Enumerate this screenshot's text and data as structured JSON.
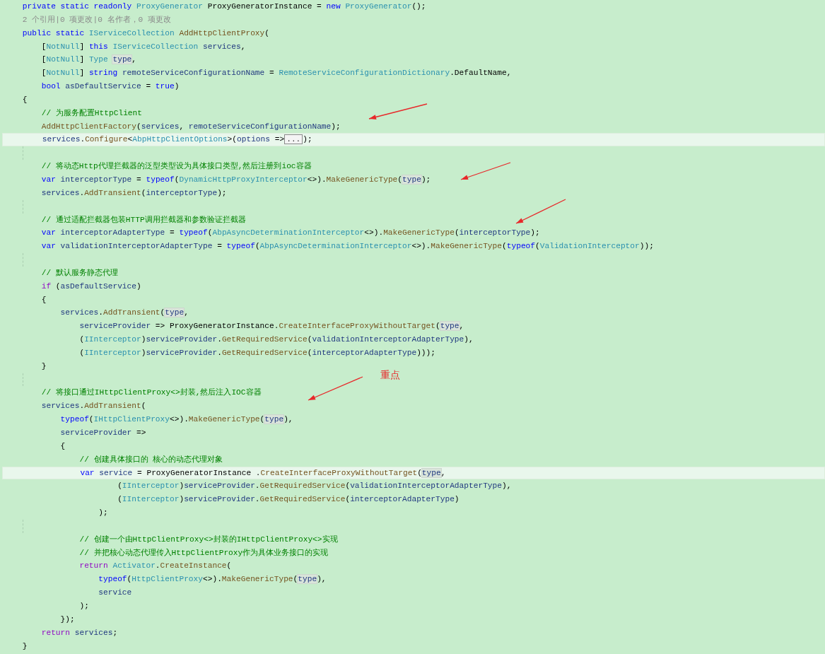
{
  "editor": {
    "lines": [
      {
        "highlighted": false,
        "tokens": [
          {
            "kind": "kw",
            "text": "    private static readonly "
          },
          {
            "kind": "type",
            "text": "ProxyGenerator"
          },
          {
            "kind": "plain",
            "text": " ProxyGeneratorInstance = "
          },
          {
            "kind": "kw",
            "text": "new "
          },
          {
            "kind": "type",
            "text": "ProxyGenerator"
          },
          {
            "kind": "plain",
            "text": "();"
          }
        ]
      },
      {
        "highlighted": false,
        "tokens": [
          {
            "kind": "lens",
            "text": "    2 个引用|0 项更改|0 名作者，0 项更改"
          }
        ]
      },
      {
        "highlighted": false,
        "tokens": [
          {
            "kind": "kw",
            "text": "    public static "
          },
          {
            "kind": "type",
            "text": "IServiceCollection "
          },
          {
            "kind": "method",
            "text": "AddHttpClientProxy"
          },
          {
            "kind": "plain",
            "text": "("
          }
        ]
      },
      {
        "highlighted": false,
        "tokens": [
          {
            "kind": "plain",
            "text": "        ["
          },
          {
            "kind": "type",
            "text": "NotNull"
          },
          {
            "kind": "plain",
            "text": "] "
          },
          {
            "kind": "kw",
            "text": "this "
          },
          {
            "kind": "type",
            "text": "IServiceCollection "
          },
          {
            "kind": "ident",
            "text": "services"
          },
          {
            "kind": "plain",
            "text": ","
          }
        ]
      },
      {
        "highlighted": false,
        "tokens": [
          {
            "kind": "plain",
            "text": "        ["
          },
          {
            "kind": "type",
            "text": "NotNull"
          },
          {
            "kind": "plain",
            "text": "] "
          },
          {
            "kind": "type",
            "text": "Type "
          },
          {
            "kind": "ref",
            "text": "type"
          },
          {
            "kind": "plain",
            "text": ","
          }
        ]
      },
      {
        "highlighted": false,
        "tokens": [
          {
            "kind": "plain",
            "text": "        ["
          },
          {
            "kind": "type",
            "text": "NotNull"
          },
          {
            "kind": "plain",
            "text": "] "
          },
          {
            "kind": "kw",
            "text": "string "
          },
          {
            "kind": "ident",
            "text": "remoteServiceConfigurationName"
          },
          {
            "kind": "plain",
            "text": " = "
          },
          {
            "kind": "type",
            "text": "RemoteServiceConfigurationDictionary"
          },
          {
            "kind": "plain",
            "text": ".DefaultName,"
          }
        ]
      },
      {
        "highlighted": false,
        "tokens": [
          {
            "kind": "kw",
            "text": "        bool "
          },
          {
            "kind": "ident",
            "text": "asDefaultService"
          },
          {
            "kind": "plain",
            "text": " = "
          },
          {
            "kind": "kw",
            "text": "true"
          },
          {
            "kind": "plain",
            "text": ")"
          }
        ]
      },
      {
        "highlighted": false,
        "tokens": [
          {
            "kind": "plain",
            "text": "    {"
          }
        ]
      },
      {
        "highlighted": false,
        "tokens": [
          {
            "kind": "comment",
            "text": "        // 为服务配置HttpClient"
          }
        ]
      },
      {
        "highlighted": false,
        "tokens": [
          {
            "kind": "method",
            "text": "        AddHttpClientFactory"
          },
          {
            "kind": "plain",
            "text": "("
          },
          {
            "kind": "ident",
            "text": "services"
          },
          {
            "kind": "plain",
            "text": ", "
          },
          {
            "kind": "ident",
            "text": "remoteServiceConfigurationName"
          },
          {
            "kind": "plain",
            "text": ");"
          }
        ]
      },
      {
        "highlighted": true,
        "tokens": [
          {
            "kind": "ident",
            "text": "        services"
          },
          {
            "kind": "plain",
            "text": "."
          },
          {
            "kind": "method",
            "text": "Configure"
          },
          {
            "kind": "plain",
            "text": "<"
          },
          {
            "kind": "type",
            "text": "AbpHttpClientOptions"
          },
          {
            "kind": "plain",
            "text": ">("
          },
          {
            "kind": "ident",
            "text": "options"
          },
          {
            "kind": "plain",
            "text": " =>"
          },
          {
            "kind": "fold",
            "text": "..."
          },
          {
            "kind": "plain",
            "text": ");"
          }
        ]
      },
      {
        "kind": "blank"
      },
      {
        "highlighted": false,
        "tokens": [
          {
            "kind": "comment",
            "text": "        // 将动态Http代理拦截器的泛型类型设为具体接口类型,然后注册到ioc容器"
          }
        ]
      },
      {
        "highlighted": false,
        "tokens": [
          {
            "kind": "kw",
            "text": "        var "
          },
          {
            "kind": "ident",
            "text": "interceptorType"
          },
          {
            "kind": "plain",
            "text": " = "
          },
          {
            "kind": "kw",
            "text": "typeof"
          },
          {
            "kind": "plain",
            "text": "("
          },
          {
            "kind": "type",
            "text": "DynamicHttpProxyInterceptor"
          },
          {
            "kind": "plain",
            "text": "<>)."
          },
          {
            "kind": "method",
            "text": "MakeGenericType"
          },
          {
            "kind": "plain",
            "text": "("
          },
          {
            "kind": "ref",
            "text": "type"
          },
          {
            "kind": "plain",
            "text": ");"
          }
        ]
      },
      {
        "highlighted": false,
        "tokens": [
          {
            "kind": "ident",
            "text": "        services"
          },
          {
            "kind": "plain",
            "text": "."
          },
          {
            "kind": "method",
            "text": "AddTransient"
          },
          {
            "kind": "plain",
            "text": "("
          },
          {
            "kind": "ident",
            "text": "interceptorType"
          },
          {
            "kind": "plain",
            "text": ");"
          }
        ]
      },
      {
        "kind": "blank"
      },
      {
        "highlighted": false,
        "tokens": [
          {
            "kind": "comment",
            "text": "        // 通过适配拦截器包装HTTP调用拦截器和参数验证拦截器"
          }
        ]
      },
      {
        "highlighted": false,
        "tokens": [
          {
            "kind": "kw",
            "text": "        var "
          },
          {
            "kind": "ident",
            "text": "interceptorAdapterType"
          },
          {
            "kind": "plain",
            "text": " = "
          },
          {
            "kind": "kw",
            "text": "typeof"
          },
          {
            "kind": "plain",
            "text": "("
          },
          {
            "kind": "type",
            "text": "AbpAsyncDeterminationInterceptor"
          },
          {
            "kind": "plain",
            "text": "<>)."
          },
          {
            "kind": "method",
            "text": "MakeGenericType"
          },
          {
            "kind": "plain",
            "text": "("
          },
          {
            "kind": "ident",
            "text": "interceptorType"
          },
          {
            "kind": "plain",
            "text": ");"
          }
        ]
      },
      {
        "highlighted": false,
        "tokens": [
          {
            "kind": "kw",
            "text": "        var "
          },
          {
            "kind": "ident",
            "text": "validationInterceptorAdapterType"
          },
          {
            "kind": "plain",
            "text": " = "
          },
          {
            "kind": "kw",
            "text": "typeof"
          },
          {
            "kind": "plain",
            "text": "("
          },
          {
            "kind": "type",
            "text": "AbpAsyncDeterminationInterceptor"
          },
          {
            "kind": "plain",
            "text": "<>)."
          },
          {
            "kind": "method",
            "text": "MakeGenericType"
          },
          {
            "kind": "plain",
            "text": "("
          },
          {
            "kind": "kw",
            "text": "typeof"
          },
          {
            "kind": "plain",
            "text": "("
          },
          {
            "kind": "type",
            "text": "ValidationInterceptor"
          },
          {
            "kind": "plain",
            "text": "));"
          }
        ]
      },
      {
        "kind": "blank"
      },
      {
        "highlighted": false,
        "tokens": [
          {
            "kind": "comment",
            "text": "        // 默认服务静态代理"
          }
        ]
      },
      {
        "highlighted": false,
        "tokens": [
          {
            "kind": "ctl",
            "text": "        if "
          },
          {
            "kind": "plain",
            "text": "("
          },
          {
            "kind": "ident",
            "text": "asDefaultService"
          },
          {
            "kind": "plain",
            "text": ")"
          }
        ]
      },
      {
        "highlighted": false,
        "tokens": [
          {
            "kind": "plain",
            "text": "        {"
          }
        ]
      },
      {
        "highlighted": false,
        "tokens": [
          {
            "kind": "ident",
            "text": "            services"
          },
          {
            "kind": "plain",
            "text": "."
          },
          {
            "kind": "method",
            "text": "AddTransient"
          },
          {
            "kind": "plain",
            "text": "("
          },
          {
            "kind": "ref",
            "text": "type"
          },
          {
            "kind": "plain",
            "text": ","
          }
        ]
      },
      {
        "highlighted": false,
        "tokens": [
          {
            "kind": "ident",
            "text": "                serviceProvider"
          },
          {
            "kind": "plain",
            "text": " => ProxyGeneratorInstance."
          },
          {
            "kind": "method",
            "text": "CreateInterfaceProxyWithoutTarget"
          },
          {
            "kind": "plain",
            "text": "("
          },
          {
            "kind": "ref",
            "text": "type"
          },
          {
            "kind": "plain",
            "text": ","
          }
        ]
      },
      {
        "highlighted": false,
        "tokens": [
          {
            "kind": "plain",
            "text": "                ("
          },
          {
            "kind": "type",
            "text": "IInterceptor"
          },
          {
            "kind": "plain",
            "text": ")"
          },
          {
            "kind": "ident",
            "text": "serviceProvider"
          },
          {
            "kind": "plain",
            "text": "."
          },
          {
            "kind": "method",
            "text": "GetRequiredService"
          },
          {
            "kind": "plain",
            "text": "("
          },
          {
            "kind": "ident",
            "text": "validationInterceptorAdapterType"
          },
          {
            "kind": "plain",
            "text": "),"
          }
        ]
      },
      {
        "highlighted": false,
        "tokens": [
          {
            "kind": "plain",
            "text": "                ("
          },
          {
            "kind": "type",
            "text": "IInterceptor"
          },
          {
            "kind": "plain",
            "text": ")"
          },
          {
            "kind": "ident",
            "text": "serviceProvider"
          },
          {
            "kind": "plain",
            "text": "."
          },
          {
            "kind": "method",
            "text": "GetRequiredService"
          },
          {
            "kind": "plain",
            "text": "("
          },
          {
            "kind": "ident",
            "text": "interceptorAdapterType"
          },
          {
            "kind": "plain",
            "text": ")));"
          }
        ]
      },
      {
        "highlighted": false,
        "tokens": [
          {
            "kind": "plain",
            "text": "        }"
          }
        ]
      },
      {
        "kind": "blank"
      },
      {
        "highlighted": false,
        "tokens": [
          {
            "kind": "comment",
            "text": "        // 将接口通过IHttpClientProxy<>封装,然后注入IOC容器"
          }
        ]
      },
      {
        "highlighted": false,
        "tokens": [
          {
            "kind": "ident",
            "text": "        services"
          },
          {
            "kind": "plain",
            "text": "."
          },
          {
            "kind": "method",
            "text": "AddTransient"
          },
          {
            "kind": "plain",
            "text": "("
          }
        ]
      },
      {
        "highlighted": false,
        "tokens": [
          {
            "kind": "kw",
            "text": "            typeof"
          },
          {
            "kind": "plain",
            "text": "("
          },
          {
            "kind": "type",
            "text": "IHttpClientProxy"
          },
          {
            "kind": "plain",
            "text": "<>)."
          },
          {
            "kind": "method",
            "text": "MakeGenericType"
          },
          {
            "kind": "plain",
            "text": "("
          },
          {
            "kind": "ref",
            "text": "type"
          },
          {
            "kind": "plain",
            "text": "),"
          }
        ]
      },
      {
        "highlighted": false,
        "tokens": [
          {
            "kind": "ident",
            "text": "            serviceProvider"
          },
          {
            "kind": "plain",
            "text": " =>"
          }
        ]
      },
      {
        "highlighted": false,
        "tokens": [
          {
            "kind": "plain",
            "text": "            {"
          }
        ]
      },
      {
        "highlighted": false,
        "tokens": [
          {
            "kind": "comment",
            "text": "                // 创建具体接口的 核心的动态代理对象"
          }
        ]
      },
      {
        "highlighted": true,
        "tokens": [
          {
            "kind": "kw",
            "text": "                var "
          },
          {
            "kind": "ident",
            "text": "service"
          },
          {
            "kind": "plain",
            "text": " = ProxyGeneratorInstance ."
          },
          {
            "kind": "method",
            "text": "CreateInterfaceProxyWithoutTarget"
          },
          {
            "kind": "plain",
            "text": "("
          },
          {
            "kind": "ref",
            "text": "type"
          },
          {
            "kind": "plain",
            "text": ","
          }
        ]
      },
      {
        "highlighted": false,
        "tokens": [
          {
            "kind": "plain",
            "text": "                        ("
          },
          {
            "kind": "type",
            "text": "IInterceptor"
          },
          {
            "kind": "plain",
            "text": ")"
          },
          {
            "kind": "ident",
            "text": "serviceProvider"
          },
          {
            "kind": "plain",
            "text": "."
          },
          {
            "kind": "method",
            "text": "GetRequiredService"
          },
          {
            "kind": "plain",
            "text": "("
          },
          {
            "kind": "ident",
            "text": "validationInterceptorAdapterType"
          },
          {
            "kind": "plain",
            "text": "),"
          }
        ]
      },
      {
        "highlighted": false,
        "tokens": [
          {
            "kind": "plain",
            "text": "                        ("
          },
          {
            "kind": "type",
            "text": "IInterceptor"
          },
          {
            "kind": "plain",
            "text": ")"
          },
          {
            "kind": "ident",
            "text": "serviceProvider"
          },
          {
            "kind": "plain",
            "text": "."
          },
          {
            "kind": "method",
            "text": "GetRequiredService"
          },
          {
            "kind": "plain",
            "text": "("
          },
          {
            "kind": "ident",
            "text": "interceptorAdapterType"
          },
          {
            "kind": "plain",
            "text": ")"
          }
        ]
      },
      {
        "highlighted": false,
        "tokens": [
          {
            "kind": "plain",
            "text": "                    );"
          }
        ]
      },
      {
        "kind": "blank"
      },
      {
        "highlighted": false,
        "tokens": [
          {
            "kind": "comment",
            "text": "                // 创建一个由HttpClientProxy<>封装的IHttpClientProxy<>实现"
          }
        ]
      },
      {
        "highlighted": false,
        "tokens": [
          {
            "kind": "comment",
            "text": "                // 并把核心动态代理传入HttpClientProxy作为具体业务接口的实现"
          }
        ]
      },
      {
        "highlighted": false,
        "tokens": [
          {
            "kind": "ctl",
            "text": "                return "
          },
          {
            "kind": "type",
            "text": "Activator"
          },
          {
            "kind": "plain",
            "text": "."
          },
          {
            "kind": "method",
            "text": "CreateInstance"
          },
          {
            "kind": "plain",
            "text": "("
          }
        ]
      },
      {
        "highlighted": false,
        "tokens": [
          {
            "kind": "kw",
            "text": "                    typeof"
          },
          {
            "kind": "plain",
            "text": "("
          },
          {
            "kind": "type",
            "text": "HttpClientProxy"
          },
          {
            "kind": "plain",
            "text": "<>)."
          },
          {
            "kind": "method",
            "text": "MakeGenericType"
          },
          {
            "kind": "plain",
            "text": "("
          },
          {
            "kind": "ref",
            "text": "type"
          },
          {
            "kind": "plain",
            "text": "),"
          }
        ]
      },
      {
        "highlighted": false,
        "tokens": [
          {
            "kind": "ident",
            "text": "                    service"
          }
        ]
      },
      {
        "highlighted": false,
        "tokens": [
          {
            "kind": "plain",
            "text": "                );"
          }
        ]
      },
      {
        "highlighted": false,
        "tokens": [
          {
            "kind": "plain",
            "text": "            });"
          }
        ]
      },
      {
        "highlighted": false,
        "tokens": [
          {
            "kind": "ctl",
            "text": "        return "
          },
          {
            "kind": "ident",
            "text": "services"
          },
          {
            "kind": "plain",
            "text": ";"
          }
        ]
      },
      {
        "highlighted": false,
        "tokens": [
          {
            "kind": "plain",
            "text": "    }"
          }
        ]
      }
    ]
  },
  "annotation": {
    "text": "重点"
  }
}
